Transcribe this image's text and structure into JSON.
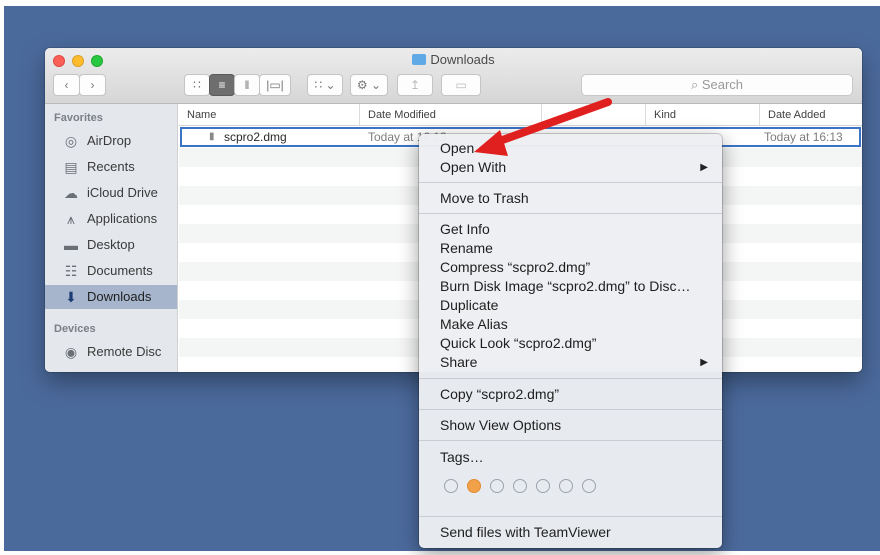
{
  "window": {
    "title": "Downloads",
    "toolbar": {
      "back_icon": "chevron-left-icon",
      "forward_icon": "chevron-right-icon",
      "search_placeholder": "Search"
    }
  },
  "sidebar": {
    "favorites_header": "Favorites",
    "devices_header": "Devices",
    "items": [
      {
        "label": "AirDrop",
        "icon": "airdrop-icon"
      },
      {
        "label": "Recents",
        "icon": "recents-icon"
      },
      {
        "label": "iCloud Drive",
        "icon": "cloud-icon"
      },
      {
        "label": "Applications",
        "icon": "applications-icon"
      },
      {
        "label": "Desktop",
        "icon": "desktop-icon"
      },
      {
        "label": "Documents",
        "icon": "documents-icon"
      },
      {
        "label": "Downloads",
        "icon": "downloads-icon",
        "selected": true
      }
    ],
    "devices": [
      {
        "label": "Remote Disc",
        "icon": "disc-icon"
      }
    ]
  },
  "columns": {
    "name": "Name",
    "date_modified": "Date Modified",
    "kind": "Kind",
    "date_added": "Date Added"
  },
  "file": {
    "name": "scpro2.dmg",
    "date_modified": "Today at 16:13",
    "date_added": "Today at 16:13"
  },
  "context_menu": {
    "open": "Open",
    "open_with": "Open With",
    "move_to_trash": "Move to Trash",
    "get_info": "Get Info",
    "rename": "Rename",
    "compress": "Compress “scpro2.dmg”",
    "burn": "Burn Disk Image “scpro2.dmg” to Disc…",
    "duplicate": "Duplicate",
    "make_alias": "Make Alias",
    "quick_look": "Quick Look “scpro2.dmg”",
    "share": "Share",
    "copy": "Copy “scpro2.dmg”",
    "show_view_options": "Show View Options",
    "tags": "Tags…",
    "send_teamviewer": "Send files with TeamViewer"
  },
  "colors": {
    "desktop": "#4b6a9c",
    "selection": "#3b73c6",
    "arrow": "#e0201f",
    "tag_orange": "#f0a14a"
  }
}
